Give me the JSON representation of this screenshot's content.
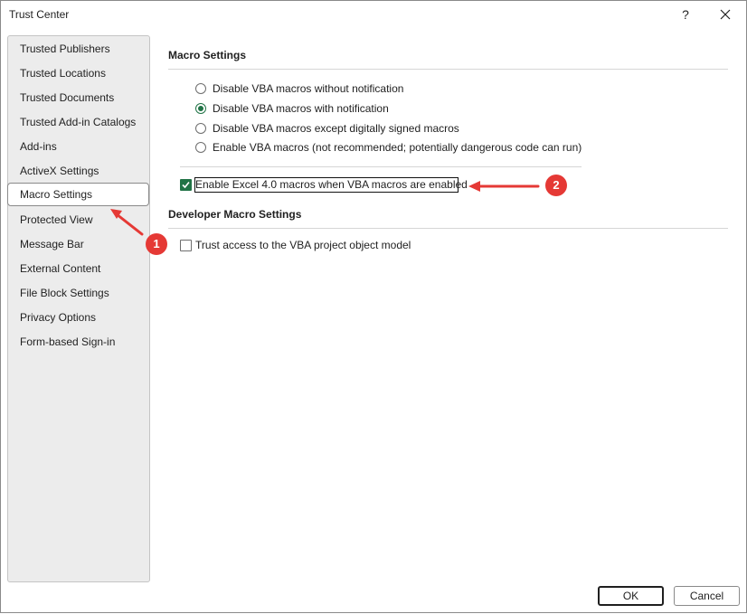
{
  "window": {
    "title": "Trust Center",
    "help_label": "?",
    "close_label": "×"
  },
  "sidebar": {
    "items": [
      {
        "label": "Trusted Publishers"
      },
      {
        "label": "Trusted Locations"
      },
      {
        "label": "Trusted Documents"
      },
      {
        "label": "Trusted Add-in Catalogs"
      },
      {
        "label": "Add-ins"
      },
      {
        "label": "ActiveX Settings"
      },
      {
        "label": "Macro Settings",
        "selected": true
      },
      {
        "label": "Protected View"
      },
      {
        "label": "Message Bar"
      },
      {
        "label": "External Content"
      },
      {
        "label": "File Block Settings"
      },
      {
        "label": "Privacy Options"
      },
      {
        "label": "Form-based Sign-in"
      }
    ]
  },
  "macro_settings": {
    "title": "Macro Settings",
    "options": [
      {
        "label": "Disable VBA macros without notification",
        "selected": false
      },
      {
        "label": "Disable VBA macros with notification",
        "selected": true
      },
      {
        "label": "Disable VBA macros except digitally signed macros",
        "selected": false
      },
      {
        "label": "Enable VBA macros (not recommended; potentially dangerous code can run)",
        "selected": false
      }
    ],
    "excel4_label": "Enable Excel 4.0 macros when VBA macros are enabled",
    "excel4_checked": true
  },
  "developer_settings": {
    "title": "Developer Macro Settings",
    "trust_vba_label": "Trust access to the VBA project object model",
    "trust_vba_checked": false
  },
  "footer": {
    "ok_label": "OK",
    "cancel_label": "Cancel"
  },
  "annotations": {
    "badge1": "1",
    "badge2": "2",
    "color": "#e53935"
  },
  "colors": {
    "accent": "#217346"
  }
}
